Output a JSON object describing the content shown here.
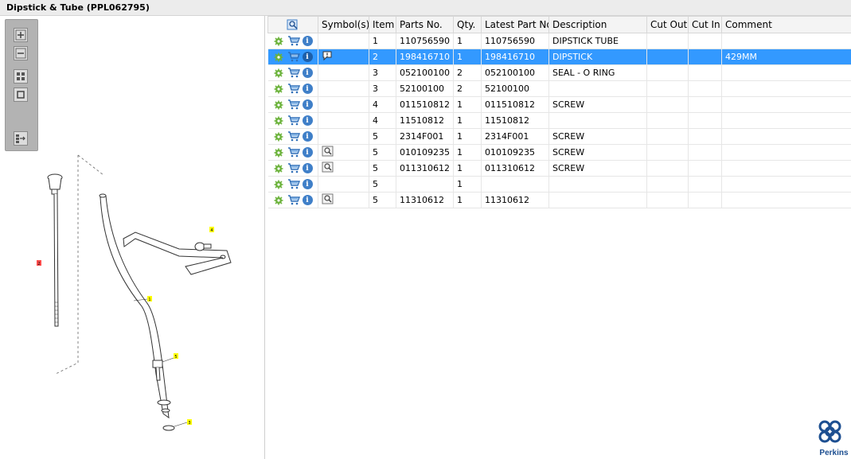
{
  "window": {
    "title": "Dipstick & Tube (PPL062795)"
  },
  "toolbar": {
    "buttons": [
      "zoom-in",
      "zoom-out",
      "fit-all",
      "fit-window",
      "toggle-layout"
    ]
  },
  "drawing": {
    "callouts": [
      "2",
      "4",
      "1",
      "5",
      "3"
    ]
  },
  "grid": {
    "columns": [
      "",
      "Symbol(s)",
      "Item",
      "Parts No.",
      "Qty.",
      "Latest Part No.",
      "Description",
      "Cut Out",
      "Cut In",
      "Comment"
    ],
    "selected_row": 1,
    "rows": [
      {
        "symbol": "",
        "item": "1",
        "part": "110756590",
        "qty": "1",
        "latest": "110756590",
        "desc": "DIPSTICK TUBE",
        "cut_out": "",
        "cut_in": "",
        "comment": ""
      },
      {
        "symbol": "comment-icon",
        "item": "2",
        "part": "198416710",
        "qty": "1",
        "latest": "198416710",
        "desc": "DIPSTICK",
        "cut_out": "",
        "cut_in": "",
        "comment": "429MM"
      },
      {
        "symbol": "",
        "item": "3",
        "part": "052100100",
        "qty": "2",
        "latest": "052100100",
        "desc": "SEAL - O RING",
        "cut_out": "",
        "cut_in": "",
        "comment": ""
      },
      {
        "symbol": "",
        "item": "3",
        "part": "52100100",
        "qty": "2",
        "latest": "52100100",
        "desc": "",
        "cut_out": "",
        "cut_in": "",
        "comment": ""
      },
      {
        "symbol": "",
        "item": "4",
        "part": "011510812",
        "qty": "1",
        "latest": "011510812",
        "desc": "SCREW",
        "cut_out": "",
        "cut_in": "",
        "comment": ""
      },
      {
        "symbol": "",
        "item": "4",
        "part": "11510812",
        "qty": "1",
        "latest": "11510812",
        "desc": "",
        "cut_out": "",
        "cut_in": "",
        "comment": ""
      },
      {
        "symbol": "",
        "item": "5",
        "part": "2314F001",
        "qty": "1",
        "latest": "2314F001",
        "desc": "SCREW",
        "cut_out": "",
        "cut_in": "",
        "comment": ""
      },
      {
        "symbol": "magnifier-icon",
        "item": "5",
        "part": "010109235",
        "qty": "1",
        "latest": "010109235",
        "desc": "SCREW",
        "cut_out": "",
        "cut_in": "",
        "comment": ""
      },
      {
        "symbol": "magnifier-icon",
        "item": "5",
        "part": "011310612",
        "qty": "1",
        "latest": "011310612",
        "desc": "SCREW",
        "cut_out": "",
        "cut_in": "",
        "comment": ""
      },
      {
        "symbol": "",
        "item": "5",
        "part": "",
        "qty": "1",
        "latest": "",
        "desc": "",
        "cut_out": "",
        "cut_in": "",
        "comment": ""
      },
      {
        "symbol": "magnifier-icon",
        "item": "5",
        "part": "11310612",
        "qty": "1",
        "latest": "11310612",
        "desc": "",
        "cut_out": "",
        "cut_in": "",
        "comment": ""
      }
    ]
  },
  "brand": {
    "name": "Perkins",
    "color": "#1d4f91"
  },
  "colors": {
    "selection": "#3399ff",
    "callout": "#ffff00",
    "callout_selected": "#ff4d4d"
  }
}
